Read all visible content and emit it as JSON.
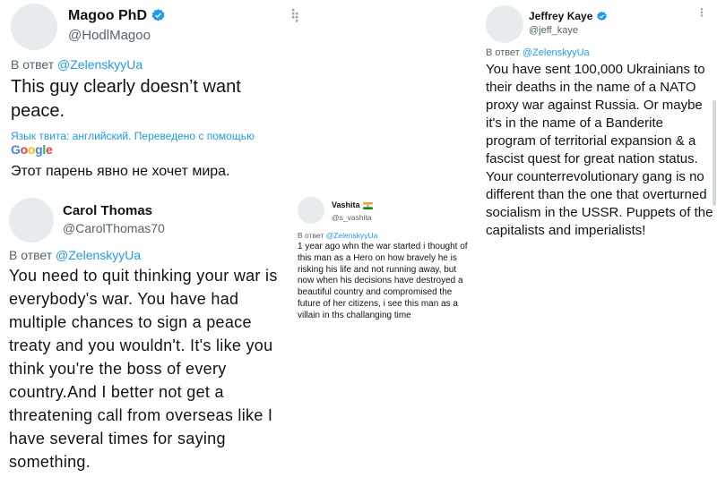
{
  "tweets": [
    {
      "name": "Magoo PhD",
      "handle": "@HodlMagoo",
      "verified": true,
      "reply_prefix": "В ответ",
      "reply_to": "@ZelenskyyUa",
      "text": "This guy clearly doesn’t want peace.",
      "translated_note": "Язык твита: английский. Переведено с помощью",
      "translator": "Google",
      "translation": "Этот парень явно не хочет мира."
    },
    {
      "name": "Carol Thomas",
      "handle": "@CarolThomas70",
      "verified": false,
      "reply_prefix": "В ответ",
      "reply_to": "@ZelenskyyUa",
      "text": "You need to quit thinking your war is everybody's war. You have had multiple chances to sign a peace treaty and you wouldn't. It's like you think you're the boss of every country.And I better not get a threatening call from overseas like I have several times for saying something."
    },
    {
      "name": "Vashita",
      "handle": "@s_vashita",
      "verified": false,
      "reply_prefix": "В ответ",
      "reply_to": "@ZelenskyyUa",
      "text": "1 year ago whn the war started i thought of this man as a Hero on how bravely he is risking his life and not running away, but now when his decisions have destroyed a beautiful country and compromised the future of her citizens, i see this man as a villain in ths challanging time"
    },
    {
      "name": "Jeffrey Kaye",
      "handle": "@jeff_kaye",
      "verified": true,
      "reply_prefix": "В ответ",
      "reply_to": "@ZelenskyyUa",
      "text": "You have sent 100,000 Ukrainians to their deaths in the name of a NATO proxy war against Russia. Or maybe it's in the name of a Banderite program of territorial expansion & a fascist quest for great nation status. Your counterrevolutionary gang is no different than the one that overturned socialism in the USSR. Puppets of the capitalists and imperialists!"
    }
  ],
  "icons": {
    "more": "more-icon",
    "verified": "verified-badge-icon",
    "flag": "india-flag-icon"
  },
  "colors": {
    "link": "#1d9bf0",
    "muted": "#536471",
    "text": "#0f1419"
  }
}
